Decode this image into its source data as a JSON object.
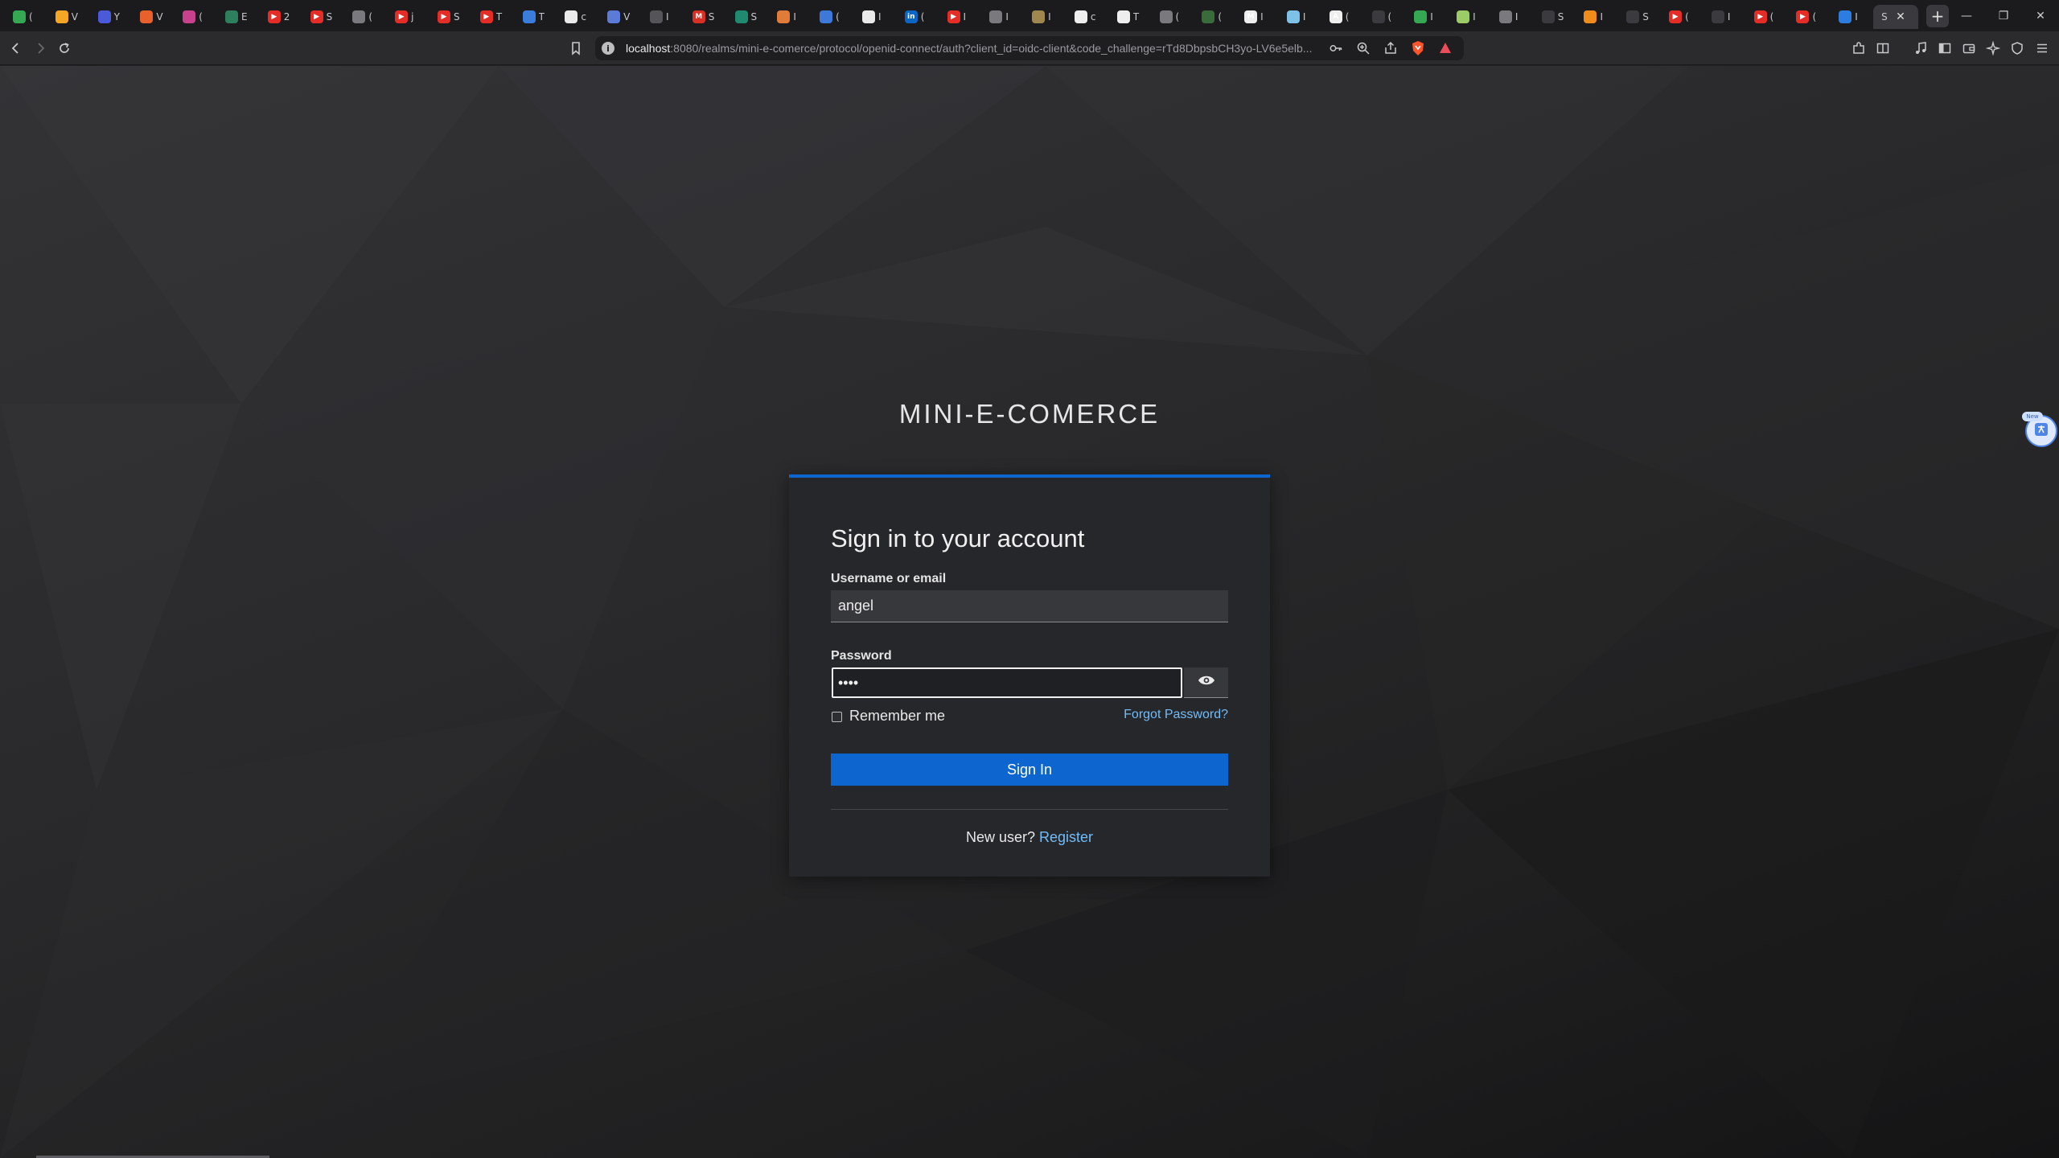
{
  "browser": {
    "tabs": [
      {
        "color": "#34a853",
        "glyph": "",
        "title": "("
      },
      {
        "color": "#f5a623",
        "glyph": "",
        "title": "V"
      },
      {
        "color": "#4a5ad8",
        "glyph": "",
        "title": "Y"
      },
      {
        "color": "#e8612c",
        "glyph": "",
        "title": "V"
      },
      {
        "color": "#c8418d",
        "glyph": "",
        "title": "("
      },
      {
        "color": "#2d7f5e",
        "glyph": "",
        "title": "E"
      },
      {
        "color": "#e52d27",
        "glyph": "▶",
        "title": "2"
      },
      {
        "color": "#e52d27",
        "glyph": "▶",
        "title": "S"
      },
      {
        "color": "#7a7a7e",
        "glyph": "",
        "title": "("
      },
      {
        "color": "#e52d27",
        "glyph": "▶",
        "title": "j"
      },
      {
        "color": "#e52d27",
        "glyph": "▶",
        "title": "S"
      },
      {
        "color": "#e52d27",
        "glyph": "▶",
        "title": "T"
      },
      {
        "color": "#3b7ddd",
        "glyph": "",
        "title": "T"
      },
      {
        "color": "#eaeaea",
        "glyph": "",
        "title": "c"
      },
      {
        "color": "#5c7bd9",
        "glyph": "",
        "title": "V"
      },
      {
        "color": "#555559",
        "glyph": "",
        "title": "I"
      },
      {
        "color": "#d93025",
        "glyph": "M",
        "title": "S"
      },
      {
        "color": "#1f8a70",
        "glyph": "",
        "title": "S"
      },
      {
        "color": "#e07b39",
        "glyph": "",
        "title": "I"
      },
      {
        "color": "#3d79d8",
        "glyph": "",
        "title": "("
      },
      {
        "color": "#eaeaea",
        "glyph": "",
        "title": "I"
      },
      {
        "color": "#0a66c2",
        "glyph": "in",
        "title": "("
      },
      {
        "color": "#e52d27",
        "glyph": "▶",
        "title": "I"
      },
      {
        "color": "#7a7a7e",
        "glyph": "",
        "title": "I"
      },
      {
        "color": "#a0864f",
        "glyph": "",
        "title": "I"
      },
      {
        "color": "#eeeeee",
        "glyph": "",
        "title": "c"
      },
      {
        "color": "#eeeeee",
        "glyph": "",
        "title": "T"
      },
      {
        "color": "#7a7a7e",
        "glyph": "",
        "title": "("
      },
      {
        "color": "#3a6b3a",
        "glyph": "",
        "title": "("
      },
      {
        "color": "#eeeeee",
        "glyph": "M",
        "title": "I"
      },
      {
        "color": "#7dc1e8",
        "glyph": "",
        "title": "I"
      },
      {
        "color": "#eeeeee",
        "glyph": "A",
        "title": "("
      },
      {
        "color": "#3b3b3f",
        "glyph": "",
        "title": "("
      },
      {
        "color": "#34a853",
        "glyph": "",
        "title": "I"
      },
      {
        "color": "#9ccc65",
        "glyph": "",
        "title": "I"
      },
      {
        "color": "#7a7a7e",
        "glyph": "",
        "title": "I"
      },
      {
        "color": "#3b3b3f",
        "glyph": "",
        "title": "S"
      },
      {
        "color": "#f08c1b",
        "glyph": "",
        "title": "I"
      },
      {
        "color": "#3b3b3f",
        "glyph": "",
        "title": "S"
      },
      {
        "color": "#e52d27",
        "glyph": "▶",
        "title": "("
      },
      {
        "color": "#3b3b3f",
        "glyph": "",
        "title": "I"
      },
      {
        "color": "#e52d27",
        "glyph": "▶",
        "title": "("
      },
      {
        "color": "#e52d27",
        "glyph": "▶",
        "title": "("
      },
      {
        "color": "#2d7ce0",
        "glyph": "",
        "title": "I"
      }
    ],
    "active_tab": {
      "title": "S",
      "close": "✕"
    },
    "new_tab": "+",
    "window": {
      "minimize": "—",
      "restore": "❐",
      "close": "✕"
    },
    "url": {
      "host": "localhost",
      "rest": ":8080/realms/mini-e-comerce/protocol/openid-connect/auth?client_id=oidc-client&code_challenge=rTd8DbpsbCH3yo-LV6e5elb..."
    }
  },
  "page": {
    "realm_title": "MINI-E-COMERCE",
    "card": {
      "heading": "Sign in to your account",
      "username_label": "Username or email",
      "username_value": "angel",
      "password_label": "Password",
      "password_value": "••••",
      "remember_label": "Remember me",
      "forgot_label": "Forgot Password?",
      "signin_label": "Sign In",
      "new_user_text": "New user?",
      "register_label": "Register"
    },
    "side_widget_tag": "New"
  },
  "colors": {
    "accent": "#0d66d0",
    "link": "#73bcf7",
    "card_bg": "#25272b"
  }
}
